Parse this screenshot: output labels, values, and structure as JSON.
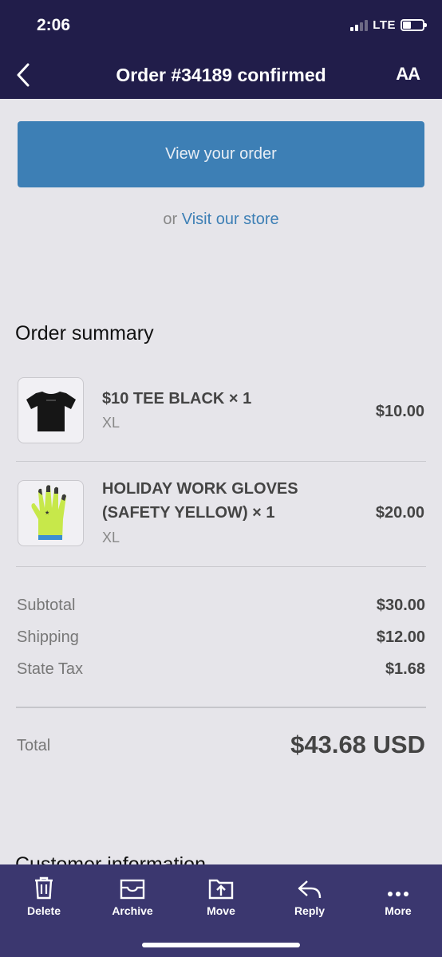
{
  "status_bar": {
    "time": "2:06",
    "network": "LTE",
    "battery_level": 0.4
  },
  "nav": {
    "title": "Order #34189 confirmed",
    "text_size_label": "AA"
  },
  "view_order_button": "View your order",
  "store_prompt": {
    "prefix": "or ",
    "link": "Visit our store"
  },
  "order_summary": {
    "heading": "Order summary",
    "items": [
      {
        "name": "$10 TEE BLACK × 1",
        "variant": "XL",
        "price": "$10.00",
        "thumb_icon": "black-tshirt-icon"
      },
      {
        "name_line1": "HOLIDAY WORK GLOVES",
        "name_line2": "(SAFETY YELLOW) × 1",
        "variant": "XL",
        "price": "$20.00",
        "thumb_icon": "yellow-glove-icon"
      }
    ],
    "costs": [
      {
        "label": "Subtotal",
        "value": "$30.00"
      },
      {
        "label": "Shipping",
        "value": "$12.00"
      },
      {
        "label": "State Tax",
        "value": "$1.68"
      }
    ],
    "total": {
      "label": "Total",
      "value": "$43.68 USD"
    }
  },
  "next_section_heading": "Customer information",
  "toolbar": {
    "delete": "Delete",
    "archive": "Archive",
    "move": "Move",
    "reply": "Reply",
    "more": "More"
  },
  "colors": {
    "header": "#211d4a",
    "toolbar": "#3b376f",
    "accent": "#3d7fb5",
    "background": "#e6e5ea"
  }
}
